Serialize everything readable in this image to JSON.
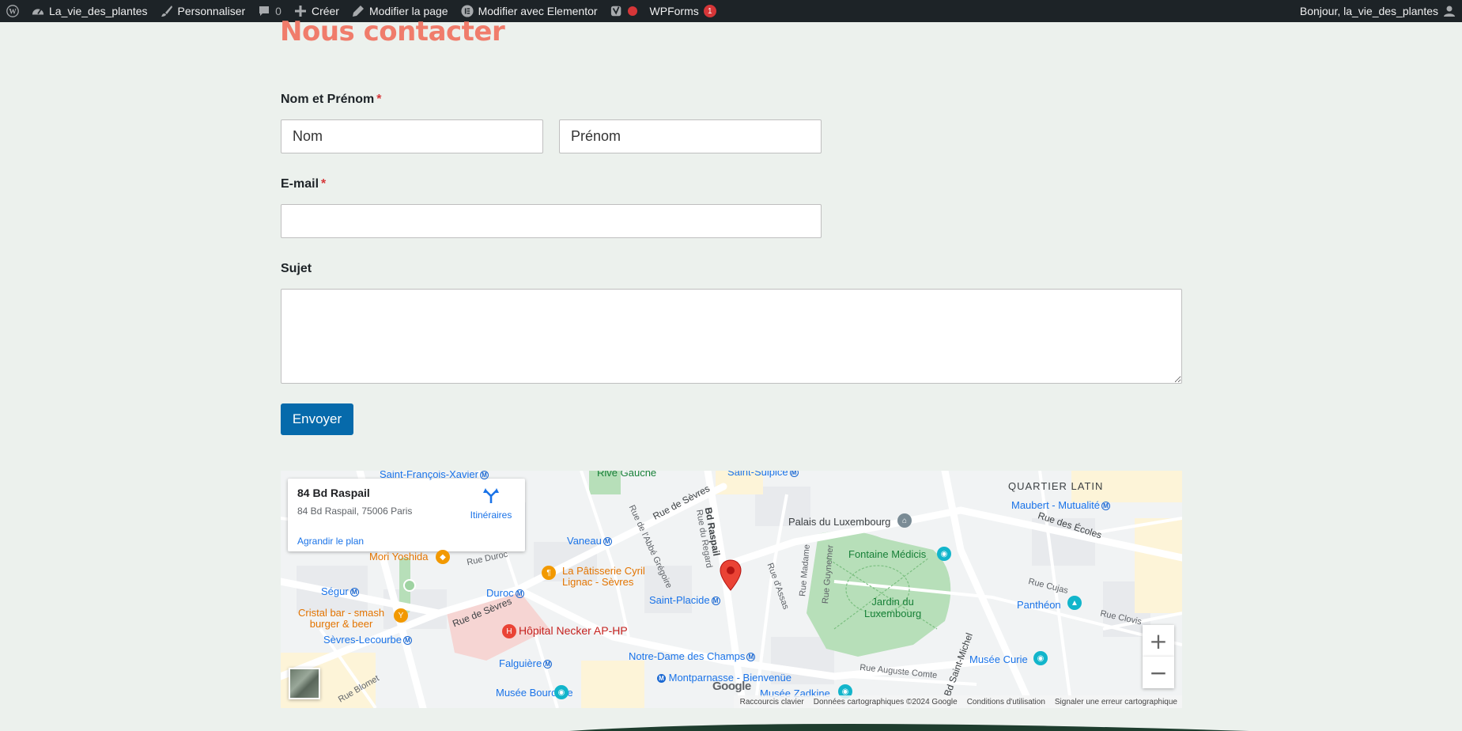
{
  "admin_bar": {
    "site_name": "La_vie_des_plantes",
    "customize": "Personnaliser",
    "comments_count": "0",
    "new": "Créer",
    "edit_page": "Modifier la page",
    "edit_elementor": "Modifier avec Elementor",
    "wpforms": "WPForms",
    "wpforms_badge": "1",
    "greeting": "Bonjour, la_vie_des_plantes"
  },
  "page": {
    "title": "Nous contacter"
  },
  "form": {
    "name_label": "Nom et Prénom",
    "required_mark": "*",
    "first_placeholder": "Nom",
    "last_placeholder": "Prénom",
    "email_label": "E-mail",
    "email_value": "",
    "subject_label": "Sujet",
    "subject_value": "",
    "submit_label": "Envoyer"
  },
  "map": {
    "card_title": "84 Bd Raspail",
    "card_address": "84 Bd Raspail, 75006 Paris",
    "directions": "Itinéraires",
    "enlarge": "Agrandir le plan",
    "zoom_in": "+",
    "zoom_out": "−",
    "google": "Google",
    "attribution": {
      "shortcuts": "Raccourcis clavier",
      "data": "Données cartographiques ©2024 Google",
      "terms": "Conditions d'utilisation",
      "report": "Signaler une erreur cartographique"
    },
    "labels": {
      "saint_francois": "Saint-François-Xavier",
      "rive_gauche": "Rive Gauche",
      "saint_sulpice": "Saint-Sulpice",
      "quartier_latin": "QUARTIER LATIN",
      "maubert": "Maubert - Mutualité",
      "rue_ecoles": "Rue des Écoles",
      "palais_lux": "Palais du Luxembourg",
      "fontaine": "Fontaine Médicis",
      "jardin_1": "Jardin du",
      "jardin_2": "Luxembourg",
      "pantheon": "Panthéon",
      "rue_clovis": "Rue Clovis",
      "rue_cujas": "Rue Cujas",
      "rue_sevres_1": "Rue de Sèvres",
      "rue_sevres_2": "Rue de Sèvres",
      "bd_raspail": "Bd Raspail",
      "rue_regard": "Rue du Regard",
      "abbe_gregoire": "Rue de l'Abbé Grégoire",
      "vaneau": "Vaneau",
      "mori": "Mori Yoshida",
      "patisserie_1": "La Pâtisserie Cyril",
      "patisserie_2": "Lignac - Sèvres",
      "rue_duroc": "Rue Duroc",
      "duroc": "Duroc",
      "segur": "Ségur",
      "cristal_1": "Cristal bar - smash",
      "cristal_2": "burger & beer",
      "sevres_lecourbe": "Sèvres-Lecourbe",
      "necker": "Hôpital Necker AP-HP",
      "saint_placide": "Saint-Placide",
      "falguiere": "Falguière",
      "notre_dame": "Notre-Dame des Champs",
      "montparnasse": "Montparnasse - Bienvenüe",
      "bourdelle": "Musée Bourdelle",
      "zadkine": "Musée Zadkine",
      "curie": "Musée Curie",
      "rue_assas": "Rue d'Assas",
      "rue_madame": "Rue Madame",
      "rue_guynemer": "Rue Guynemer",
      "auguste_comte": "Rue Auguste Comte",
      "st_michel": "Bd Saint-Michel",
      "rue_blomet": "Rue Blomet",
      "metro_letter": "M",
      "hospital_letter": "H"
    }
  },
  "colors": {
    "title": "#f07c6b",
    "button": "#066aab",
    "admin_bar": "#1d2327",
    "background": "#ecf1ed"
  }
}
